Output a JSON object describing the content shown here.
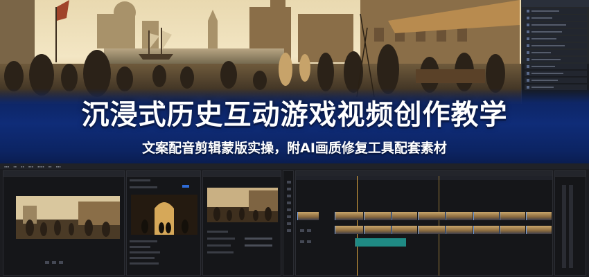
{
  "banner": {
    "title": "沉浸式历史互动游戏视频创作教学",
    "subtitle": "文案配音剪辑蒙版实操，附AI画质修复工具配套素材"
  },
  "colors": {
    "title_band": "#0f2c78",
    "editor_bg": "#1b1c20",
    "clip_audio": "#1f8a84",
    "playhead": "#e0a840",
    "accent": "#3d7bff"
  },
  "editor": {
    "panels": [
      "source-monitor",
      "effect-controls",
      "program-monitor",
      "tools",
      "timeline",
      "audio-meter"
    ]
  }
}
